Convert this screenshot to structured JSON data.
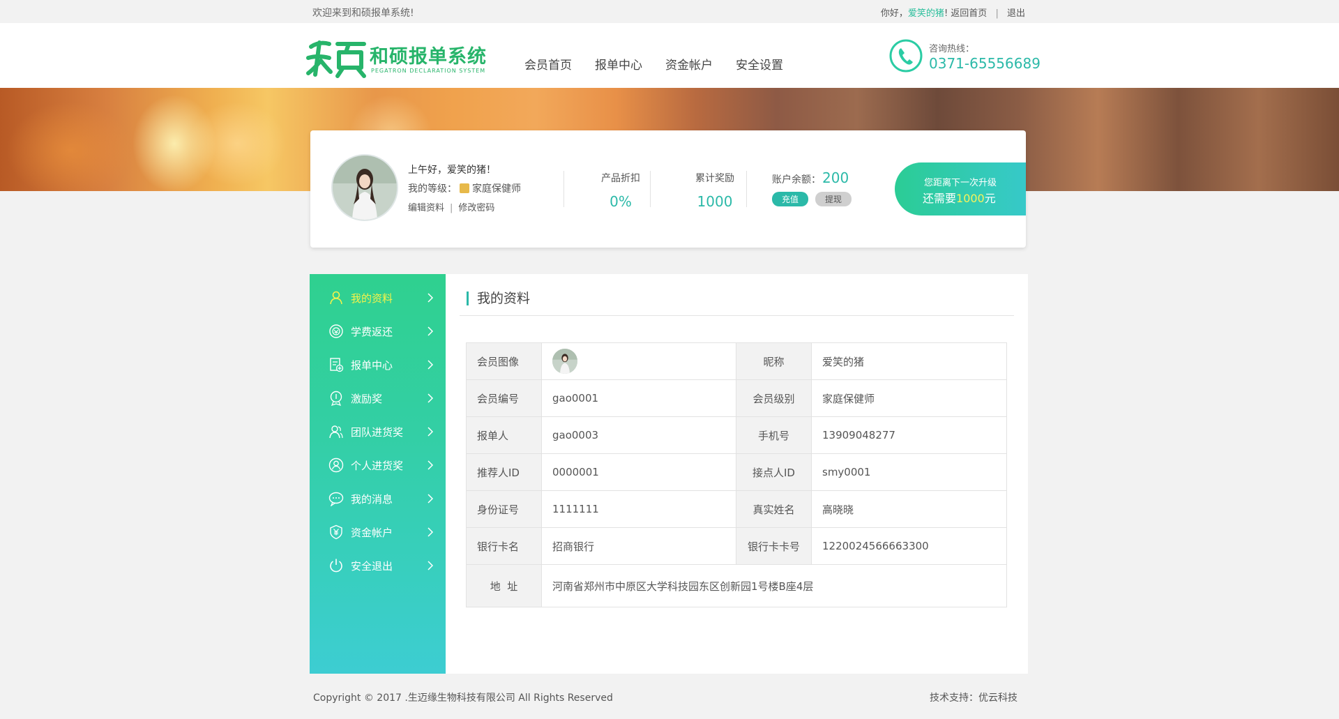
{
  "topbar": {
    "welcome": "欢迎来到和硕报单系统!",
    "greeting_prefix": "你好，",
    "username": "爱笑的猪",
    "greeting_suffix": "!",
    "home_link": "返回首页",
    "logout_link": "退出"
  },
  "header": {
    "logo_title": "和硕报单系统",
    "logo_subtitle": "PEGATRON DECLARATION SYSTEM",
    "nav": [
      "会员首页",
      "报单中心",
      "资金帐户",
      "安全设置"
    ],
    "hotline_label": "咨询热线：",
    "hotline_number": "0371-65556689"
  },
  "profile": {
    "greeting": "上午好，爱笑的猪！",
    "level_label": "我的等级：",
    "level_value": "家庭保健师",
    "edit_profile": "编辑资料",
    "change_password": "修改密码",
    "discount_label": "产品折扣",
    "discount_value": "0%",
    "reward_label": "累计奖励",
    "reward_value": "1000",
    "balance_label": "账户余额：",
    "balance_value": "200",
    "recharge_button": "充值",
    "withdraw_button": "提现",
    "upgrade_line1": "您距离下一次升级",
    "upgrade_line2_prefix": "还需要",
    "upgrade_amount": "1000",
    "upgrade_line2_suffix": "元"
  },
  "sidebar": {
    "items": [
      {
        "label": "我的资料",
        "icon": "user-icon",
        "active": true
      },
      {
        "label": "学费返还",
        "icon": "refund-icon",
        "active": false
      },
      {
        "label": "报单中心",
        "icon": "document-add-icon",
        "active": false
      },
      {
        "label": "激励奖",
        "icon": "medal-icon",
        "active": false
      },
      {
        "label": "团队进货奖",
        "icon": "team-icon",
        "active": false
      },
      {
        "label": "个人进货奖",
        "icon": "person-circle-icon",
        "active": false
      },
      {
        "label": "我的消息",
        "icon": "message-icon",
        "active": false
      },
      {
        "label": "资金帐户",
        "icon": "yuan-shield-icon",
        "active": false
      },
      {
        "label": "安全退出",
        "icon": "power-icon",
        "active": false
      }
    ]
  },
  "content": {
    "title": "我的资料",
    "rows": [
      {
        "k1": "会员图像",
        "v1": "",
        "k2": "昵称",
        "v2": "爱笑的猪"
      },
      {
        "k1": "会员编号",
        "v1": "gao0001",
        "k2": "会员级别",
        "v2": "家庭保健师"
      },
      {
        "k1": "报单人",
        "v1": "gao0003",
        "k2": "手机号",
        "v2": "13909048277"
      },
      {
        "k1": "推荐人ID",
        "v1": "0000001",
        "k2": "接点人ID",
        "v2": "smy0001"
      },
      {
        "k1": "身份证号",
        "v1": "1111111",
        "k2": "真实姓名",
        "v2": "高晓晓"
      },
      {
        "k1": "银行卡名",
        "v1": "招商银行",
        "k2": "银行卡卡号",
        "v2": "1220024566663300"
      }
    ],
    "address_label": "地  址",
    "address_value": "河南省郑州市中原区大学科技园东区创新园1号楼B座4层"
  },
  "footer": {
    "copyright": "Copyright © 2017 .生迈缘生物科技有限公司  All Rights Reserved",
    "support": "技术支持：优云科技"
  },
  "colors": {
    "accent": "#2bb9a8",
    "logo_green": "#27b46a",
    "highlight_yellow": "#f6f34a"
  }
}
